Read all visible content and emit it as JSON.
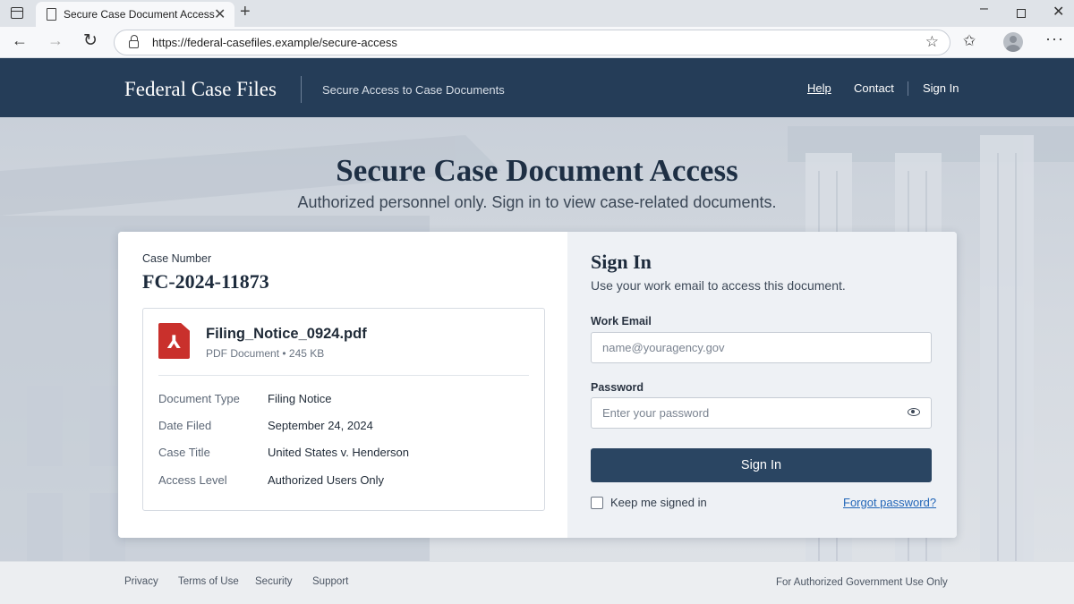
{
  "browser": {
    "tab_title": "Secure Case Document Access",
    "url": "https://federal-casefiles.example/secure-access"
  },
  "header": {
    "brand": "Federal Case Files",
    "tagline": "Secure Access to Case Documents",
    "nav": {
      "help": "Help",
      "contact": "Contact",
      "sign_in": "Sign In"
    }
  },
  "hero": {
    "title": "Secure Case Document Access",
    "subtitle": "Authorized personnel only. Sign in to view case-related documents."
  },
  "document": {
    "case_label": "Case Number",
    "case_number": "FC-2024-11873",
    "file_name": "Filing_Notice_0924.pdf",
    "file_meta": "PDF Document • 245 KB",
    "details": [
      {
        "key": "Document Type",
        "value": "Filing Notice"
      },
      {
        "key": "Date Filed",
        "value": "September 24, 2024"
      },
      {
        "key": "Case Title",
        "value": "United States v. Henderson"
      },
      {
        "key": "Access Level",
        "value": "Authorized Users Only"
      }
    ]
  },
  "signin": {
    "title": "Sign In",
    "subtitle": "Use your work email to access this document.",
    "email_label": "Work Email",
    "email_placeholder": "name@youragency.gov",
    "password_label": "Password",
    "password_placeholder": "Enter your password",
    "button": "Sign In",
    "keep_signed_in": "Keep me signed in",
    "forgot": "Forgot password?"
  },
  "footer": {
    "links": [
      "Privacy",
      "Terms of Use",
      "Security",
      "Support"
    ],
    "note": "For Authorized Government Use Only"
  },
  "colors": {
    "header_bg": "#253d58",
    "button_bg": "#2a4562",
    "link": "#2266b8",
    "pdf_red": "#c9302c"
  },
  "icons": [
    "window-icon",
    "document-icon",
    "close-icon",
    "plus-icon",
    "back-arrow-icon",
    "forward-arrow-icon",
    "reload-icon",
    "lock-icon",
    "star-icon",
    "favorites-icon",
    "profile-icon",
    "more-icon",
    "pdf-icon",
    "eye-icon"
  ]
}
